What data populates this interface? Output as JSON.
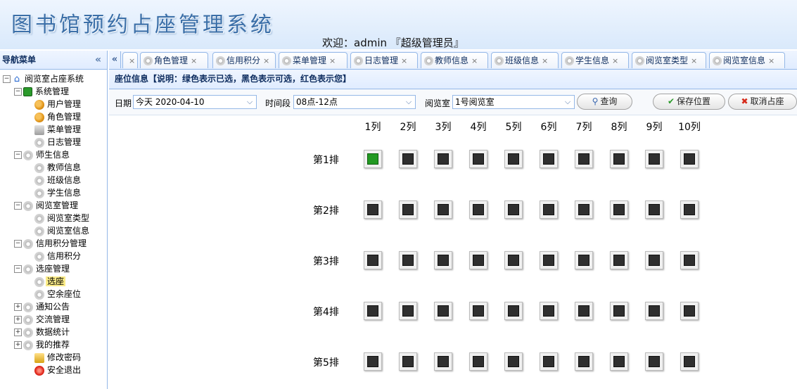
{
  "header": {
    "title": "图书馆预约占座管理系统",
    "welcome": "欢迎：admin 『超级管理员』"
  },
  "nav": {
    "title": "导航菜单",
    "collapse": "«",
    "items": [
      {
        "label": "阅览室占座系统",
        "toggle": "−",
        "icon": "home-icon"
      },
      {
        "label": "系统管理",
        "toggle": "−",
        "icon": "folder-icon"
      },
      {
        "label": "用户管理",
        "icon": "users-icon"
      },
      {
        "label": "角色管理",
        "icon": "roles-icon"
      },
      {
        "label": "菜单管理",
        "icon": "menu-icon"
      },
      {
        "label": "日志管理",
        "icon": "gear-icon"
      },
      {
        "label": "师生信息",
        "toggle": "−",
        "icon": "gear-icon"
      },
      {
        "label": "教师信息",
        "icon": "gear-icon"
      },
      {
        "label": "班级信息",
        "icon": "gear-icon"
      },
      {
        "label": "学生信息",
        "icon": "gear-icon"
      },
      {
        "label": "阅览室管理",
        "toggle": "−",
        "icon": "gear-icon"
      },
      {
        "label": "阅览室类型",
        "icon": "gear-icon"
      },
      {
        "label": "阅览室信息",
        "icon": "gear-icon"
      },
      {
        "label": "信用积分管理",
        "toggle": "−",
        "icon": "gear-icon"
      },
      {
        "label": "信用积分",
        "icon": "gear-icon"
      },
      {
        "label": "选座管理",
        "toggle": "−",
        "icon": "gear-icon"
      },
      {
        "label": "选座",
        "icon": "gear-icon"
      },
      {
        "label": "空余座位",
        "icon": "gear-icon"
      },
      {
        "label": "通知公告",
        "toggle": "+",
        "icon": "gear-icon"
      },
      {
        "label": "交流管理",
        "toggle": "+",
        "icon": "gear-icon"
      },
      {
        "label": "数据统计",
        "toggle": "+",
        "icon": "gear-icon"
      },
      {
        "label": "我的推荐",
        "toggle": "+",
        "icon": "gear-icon"
      },
      {
        "label": "修改密码",
        "icon": "key-icon"
      },
      {
        "label": "安全退出",
        "icon": "exit-icon"
      }
    ]
  },
  "tabs": {
    "scroll_left": "«",
    "close": "×",
    "items": [
      {
        "label": ""
      },
      {
        "label": "角色管理"
      },
      {
        "label": "信用积分"
      },
      {
        "label": "菜单管理"
      },
      {
        "label": "日志管理"
      },
      {
        "label": "教师信息"
      },
      {
        "label": "班级信息"
      },
      {
        "label": "学生信息"
      },
      {
        "label": "阅览室类型"
      },
      {
        "label": "阅览室信息"
      }
    ]
  },
  "panel": {
    "title": "座位信息【说明：绿色表示已选，黑色表示可选，红色表示您】",
    "date_label": "日期",
    "date_value": "今天  2020-04-10",
    "period_label": "时间段",
    "period_value": "08点-12点",
    "room_label": "阅览室",
    "room_value": "1号阅览室",
    "query_button": "查询",
    "save_button": "保存位置",
    "cancel_button": "取消占座"
  },
  "seats": {
    "columns": [
      "1列",
      "2列",
      "3列",
      "4列",
      "5列",
      "6列",
      "7列",
      "8列",
      "9列",
      "10列"
    ],
    "rows": [
      "第1排",
      "第2排",
      "第3排",
      "第4排",
      "第5排"
    ],
    "taken": [
      [
        0,
        0
      ]
    ],
    "colors": {
      "taken": "#229922",
      "available": "#2f2f2f",
      "mine": "#dd2222"
    }
  }
}
